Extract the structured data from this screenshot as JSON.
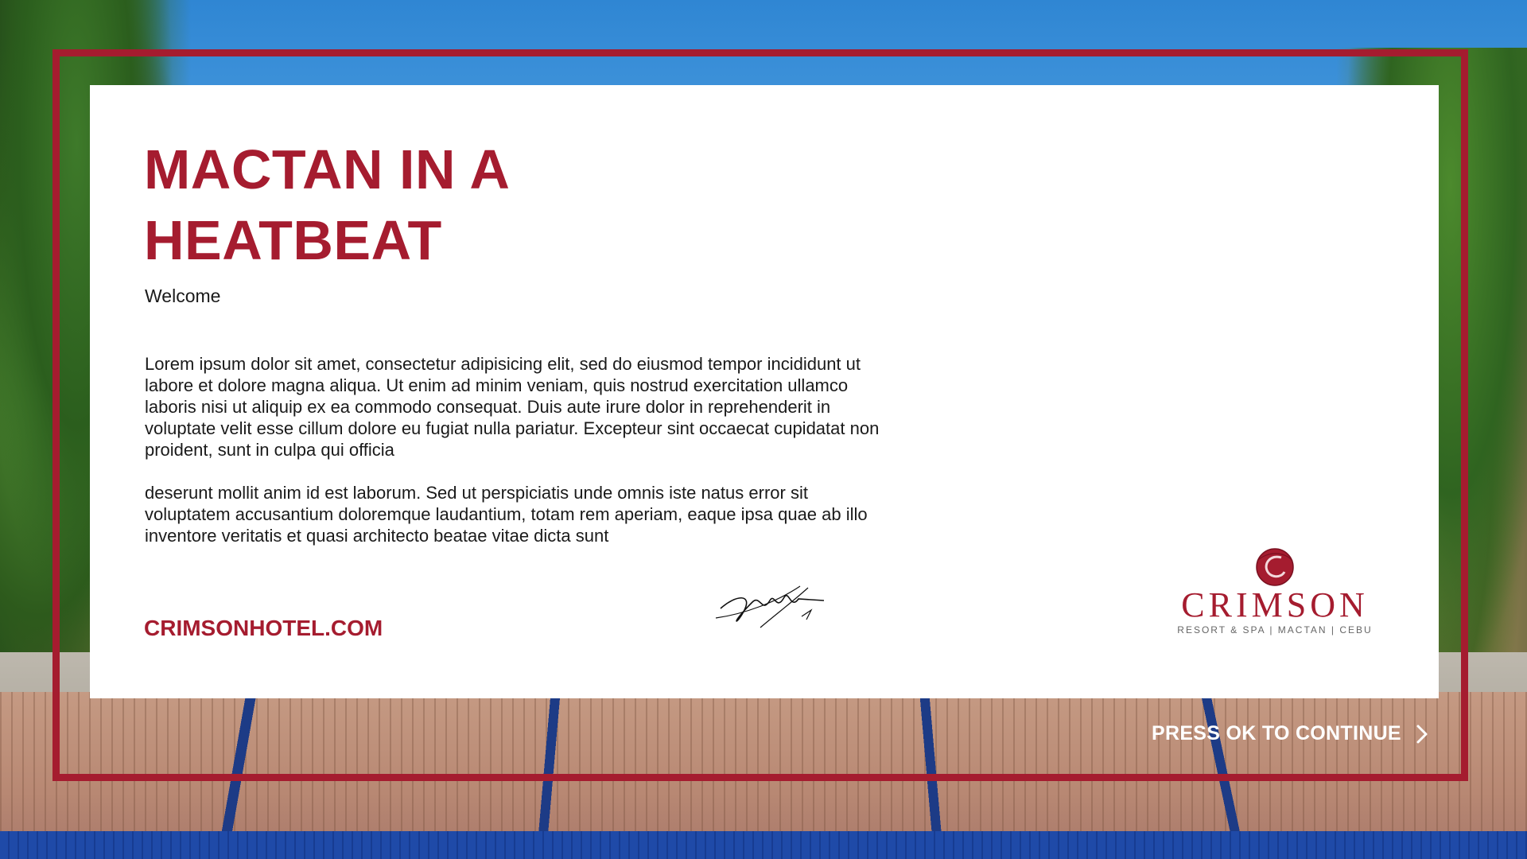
{
  "content": {
    "title_line1": "MACTAN IN A",
    "title_line2": "HEATBEAT",
    "welcome": "Welcome",
    "paragraph1": "Lorem ipsum dolor sit amet, consectetur adipisicing elit, sed do eiusmod tempor incididunt ut labore et dolore magna aliqua. Ut enim ad minim veniam, quis nostrud exercitation ullamco laboris nisi ut aliquip ex ea commodo consequat. Duis aute irure dolor in reprehenderit in voluptate velit esse cillum dolore eu fugiat nulla pariatur. Excepteur sint occaecat cupidatat non proident, sunt in culpa qui officia",
    "paragraph2": "deserunt mollit anim id est laborum. Sed ut perspiciatis unde omnis iste natus error sit voluptatem accusantium doloremque laudantium, totam rem aperiam, eaque ipsa quae ab illo inventore veritatis et quasi architecto beatae vitae dicta sunt",
    "website": "CRIMSONHOTEL.COM"
  },
  "logo": {
    "name": "CRIMSON",
    "tagline": "RESORT & SPA | MACTAN | CEBU",
    "icon": "crimson-circle-logo-icon"
  },
  "signature": {
    "icon": "signature-icon"
  },
  "navigation": {
    "continue_label": "PRESS OK TO CONTINUE",
    "continue_icon": "chevron-right-icon"
  },
  "colors": {
    "brand": "#a51c2f",
    "card": "#ffffff",
    "text": "#1a1a1a",
    "continue_text": "#ffffff"
  }
}
